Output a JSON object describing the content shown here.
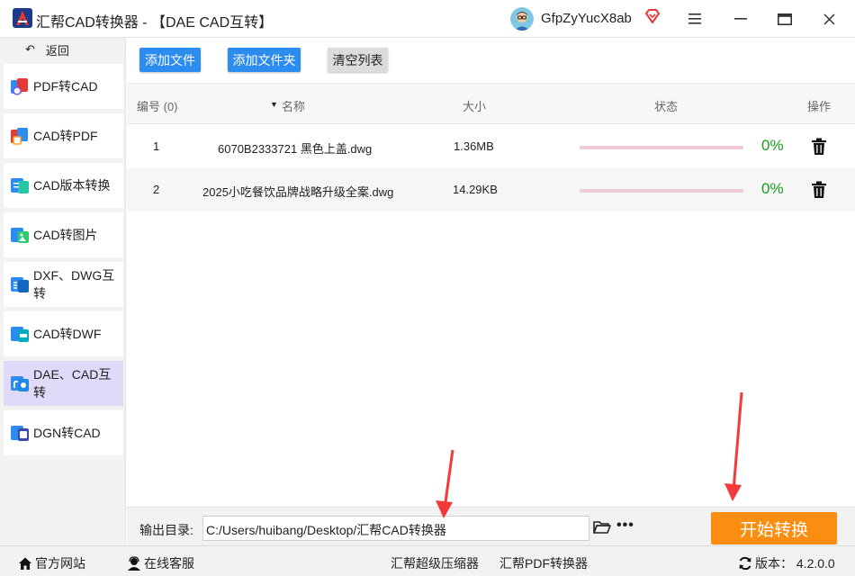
{
  "window": {
    "title": "汇帮CAD转换器 - 【DAE CAD互转】",
    "user_name": "GfpZyYucX8ab"
  },
  "sidebar": {
    "back_label": "返回",
    "items": [
      {
        "label": "PDF转CAD",
        "active": false
      },
      {
        "label": "CAD转PDF",
        "active": false
      },
      {
        "label": "CAD版本转换",
        "active": false
      },
      {
        "label": "CAD转图片",
        "active": false
      },
      {
        "label": "DXF、DWG互转",
        "active": false
      },
      {
        "label": "CAD转DWF",
        "active": false
      },
      {
        "label": "DAE、CAD互转",
        "active": true
      },
      {
        "label": "DGN转CAD",
        "active": false
      }
    ]
  },
  "toolbar": {
    "add_file": "添加文件",
    "add_folder": "添加文件夹",
    "clear_list": "清空列表"
  },
  "table": {
    "headers": {
      "index": "编号 (0)",
      "name": "名称",
      "size": "大小",
      "status": "状态",
      "action": "操作"
    },
    "rows": [
      {
        "index": "1",
        "name": "6070B2333721 黑色上盖.dwg",
        "size": "1.36MB",
        "progress": 0,
        "percent": "0%"
      },
      {
        "index": "2",
        "name": "2025小吃餐饮品牌战略升级全案.dwg",
        "size": "14.29KB",
        "progress": 0,
        "percent": "0%"
      }
    ]
  },
  "output": {
    "label": "输出目录:",
    "path": "C:/Users/huibang/Desktop/汇帮CAD转换器",
    "start_button": "开始转换"
  },
  "footer": {
    "website": "官方网站",
    "support": "在线客服",
    "compressor": "汇帮超级压缩器",
    "pdf_converter": "汇帮PDF转换器",
    "version": "版本： 4.2.0.0"
  },
  "colors": {
    "primary_blue": "#2d8cf0",
    "start_orange": "#fb8d10",
    "active_sidebar": "#e0d9f7",
    "progress_track": "#f0c9d8",
    "percent_green": "#1aa01a",
    "annotation_red": "#f23a3a"
  }
}
